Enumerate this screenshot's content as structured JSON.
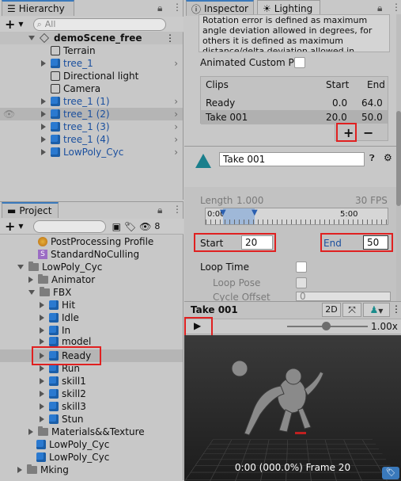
{
  "hierarchy": {
    "tab": "Hierarchy",
    "search_placeholder": "All",
    "scene": "demoScene_free",
    "items": [
      {
        "label": "Terrain",
        "kind": "outline"
      },
      {
        "label": "tree_1",
        "kind": "prefab",
        "expand": true
      },
      {
        "label": "Directional light",
        "kind": "outline"
      },
      {
        "label": "Camera",
        "kind": "outline"
      },
      {
        "label": "tree_1 (1)",
        "kind": "prefab",
        "expand": true
      },
      {
        "label": "tree_1 (2)",
        "kind": "prefab",
        "expand": true
      },
      {
        "label": "tree_1 (3)",
        "kind": "prefab",
        "expand": true
      },
      {
        "label": "tree_1 (4)",
        "kind": "prefab",
        "expand": true
      },
      {
        "label": "LowPoly_Cyc",
        "kind": "prefab",
        "expand": true
      }
    ]
  },
  "project": {
    "tab": "Project",
    "badge": "8",
    "items": [
      {
        "label": "PostProcessing Profile"
      },
      {
        "label": "StandardNoCulling"
      },
      {
        "label": "LowPoly_Cyc"
      },
      {
        "label": "Animator"
      },
      {
        "label": "FBX"
      },
      {
        "label": "Hit"
      },
      {
        "label": "Idle"
      },
      {
        "label": "In"
      },
      {
        "label": "model"
      },
      {
        "label": "Ready"
      },
      {
        "label": "Run"
      },
      {
        "label": "skill1"
      },
      {
        "label": "skill2"
      },
      {
        "label": "skill3"
      },
      {
        "label": "Stun"
      },
      {
        "label": "Materials&&Texture"
      },
      {
        "label": "LowPoly_Cyc"
      },
      {
        "label": "LowPoly_Cyc"
      },
      {
        "label": "Mking"
      }
    ]
  },
  "inspector": {
    "tab": "Inspector",
    "tab2": "Lighting",
    "help_text": "Rotation error is defined as maximum angle deviation allowed in degrees, for others it is defined as maximum distance/delta deviation allowed in percents",
    "animated_custom": "Animated Custom Prc",
    "clips_header": {
      "name": "Clips",
      "start": "Start",
      "end": "End"
    },
    "clips": [
      {
        "name": "Ready",
        "start": "0.0",
        "end": "64.0"
      },
      {
        "name": "Take 001",
        "start": "20.0",
        "end": "50.0"
      }
    ],
    "plus": "+",
    "minus": "−",
    "clip_name": "Take 001",
    "length_label": "Length",
    "length_value": "1.000",
    "fps": "30 FPS",
    "ruler_start": "0:00",
    "ruler_mid": "5:00",
    "start_label": "Start",
    "start_value": "20",
    "end_label": "End",
    "end_value": "50",
    "loop_time": "Loop Time",
    "loop_pose": "Loop Pose",
    "cycle_offset": "Cycle Offset",
    "cycle_value": "0"
  },
  "preview": {
    "title": "Take 001",
    "btn_2d": "2D",
    "speed": "1.00x",
    "status": "0:00 (000.0%) Frame 20"
  }
}
